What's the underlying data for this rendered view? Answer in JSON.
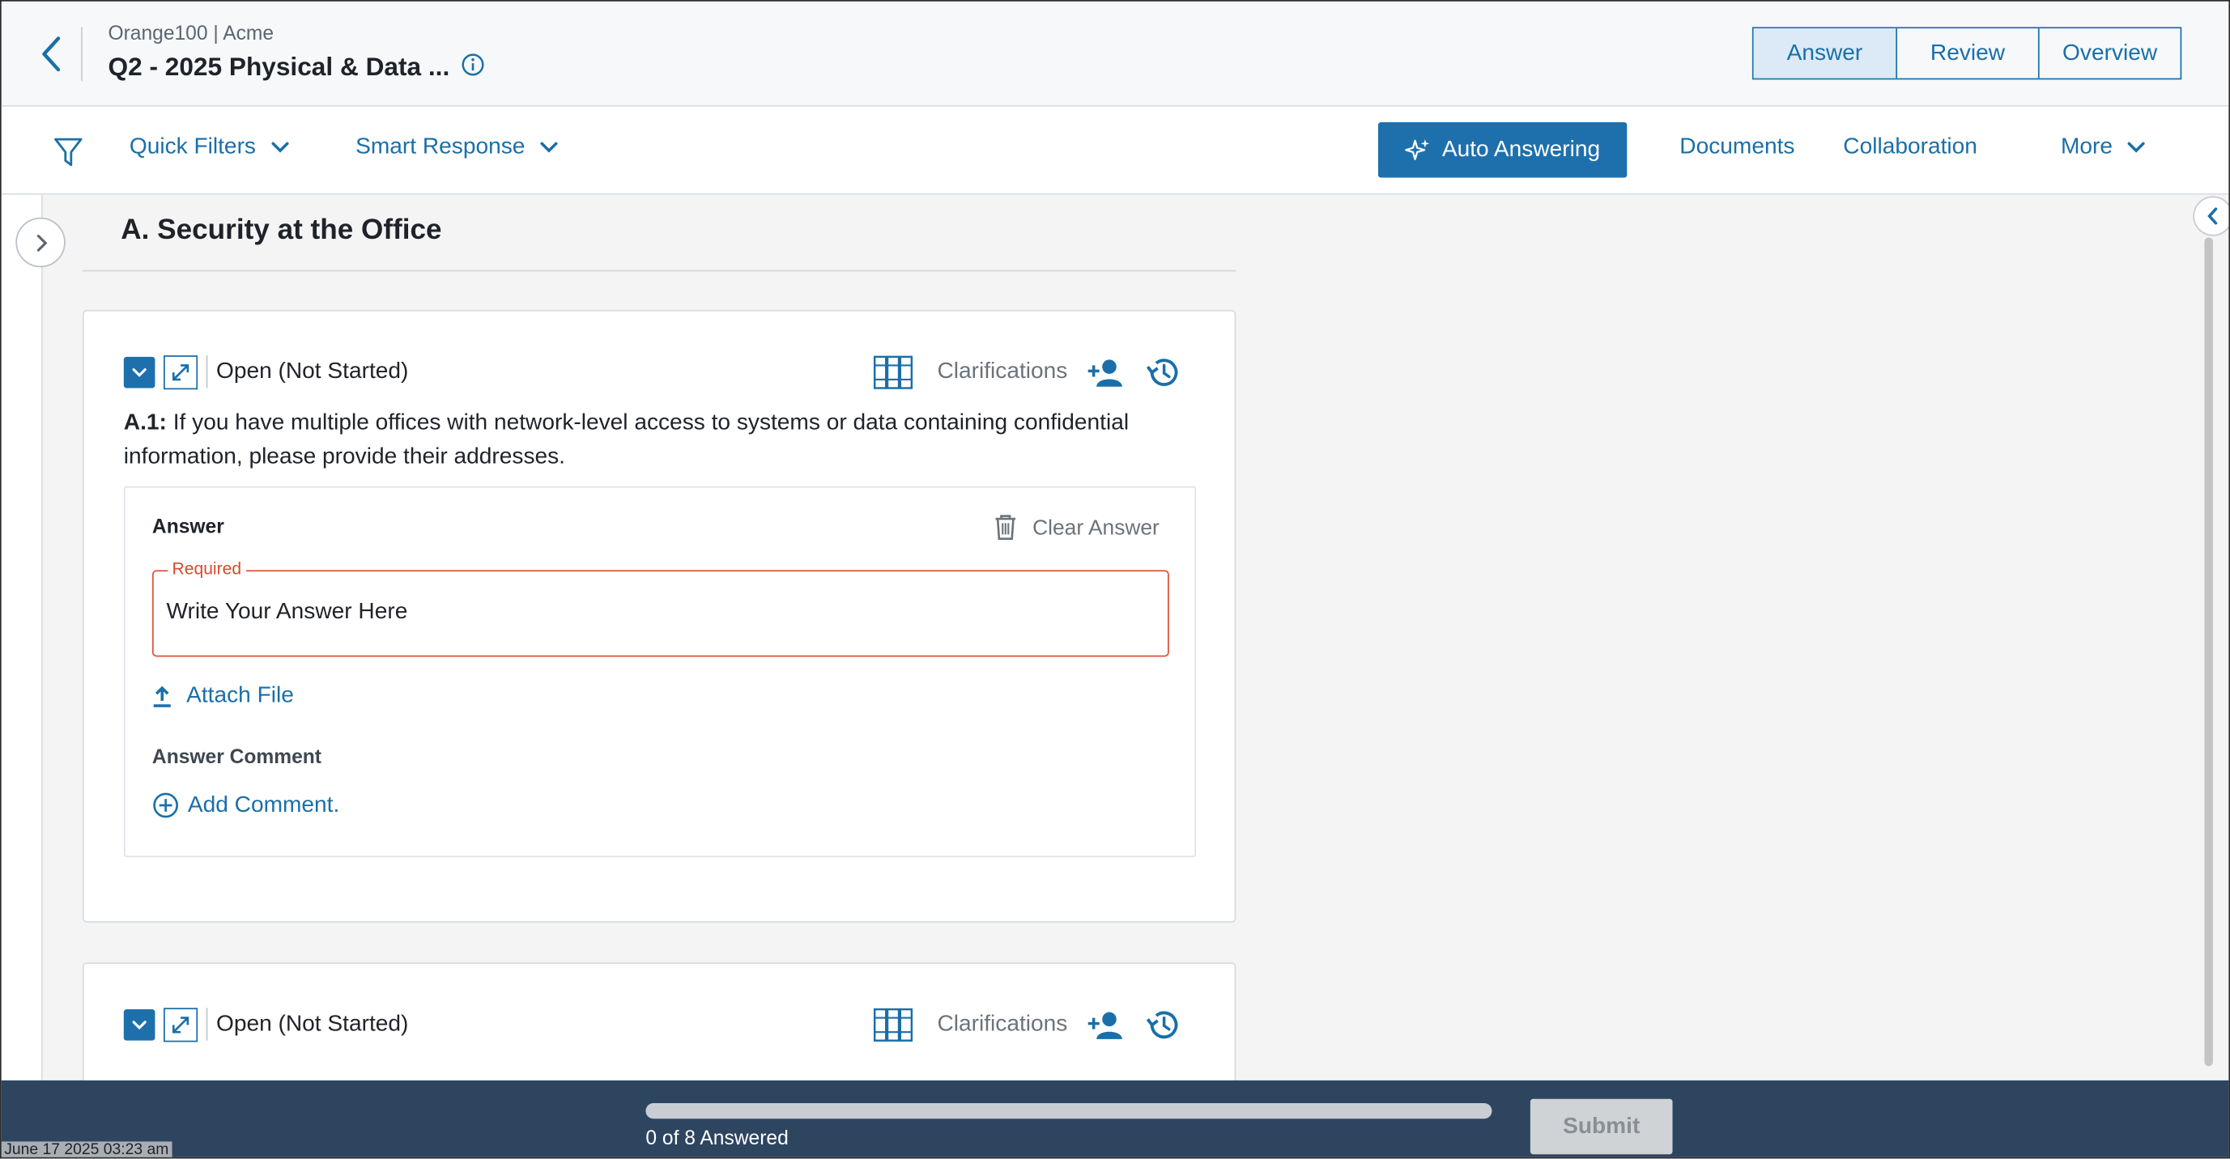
{
  "header": {
    "breadcrumb": "Orange100 | Acme",
    "title": "Q2 - 2025 Physical & Data ...",
    "tabs": [
      "Answer",
      "Review",
      "Overview"
    ],
    "active_tab": "Answer"
  },
  "toolbar": {
    "quick_filters": "Quick Filters",
    "smart_response": "Smart Response",
    "auto_answering": "Auto Answering",
    "documents": "Documents",
    "collaboration": "Collaboration",
    "more": "More"
  },
  "section": {
    "title": "A. Security at the Office"
  },
  "questions": [
    {
      "status": "Open (Not Started)",
      "clarifications": "Clarifications",
      "number": "A.1:",
      "text": "If you have multiple offices with network-level access to systems or data containing confidential information, please provide their addresses.",
      "answer_label": "Answer",
      "clear_answer": "Clear Answer",
      "required_label": "Required",
      "answer_placeholder": "Write Your Answer Here",
      "attach_file": "Attach File",
      "comment_label": "Answer Comment",
      "add_comment": "Add Comment."
    },
    {
      "status": "Open (Not Started)",
      "clarifications": "Clarifications"
    }
  ],
  "footer": {
    "progress_text": "0 of 8 Answered",
    "progress_fraction": 0,
    "submit": "Submit",
    "timestamp": "June 17 2025 03:23 am"
  },
  "colors": {
    "accent": "#1e70ad",
    "required": "#e0513c",
    "footer_bg": "#2e4560"
  }
}
